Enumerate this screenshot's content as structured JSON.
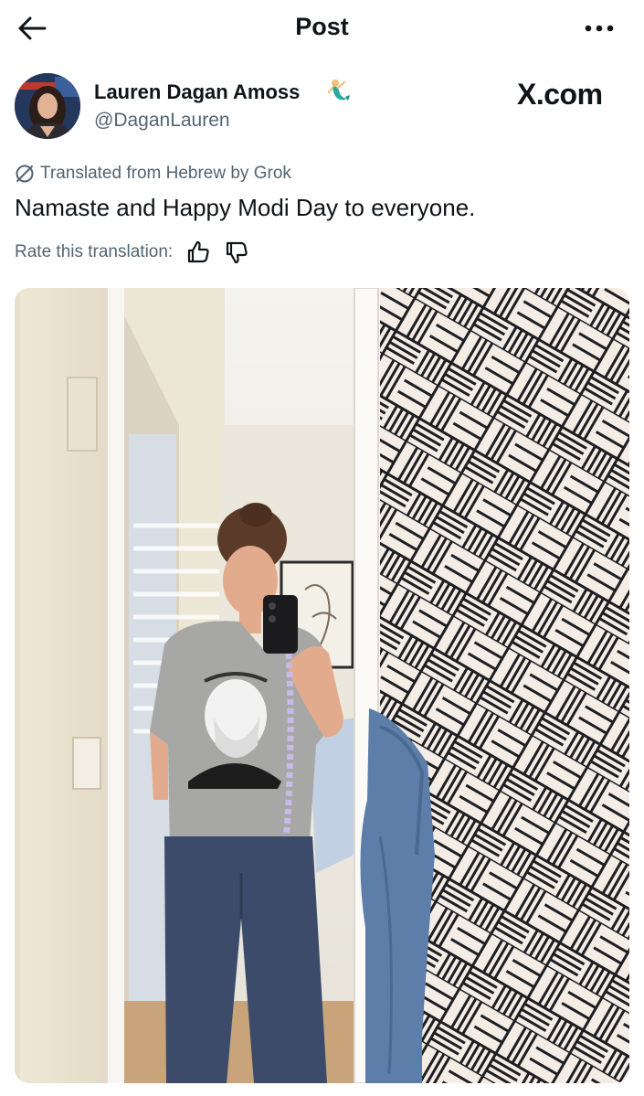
{
  "header": {
    "title": "Post"
  },
  "author": {
    "name": "Lauren Dagan Amoss",
    "handle": "@DaganLauren",
    "badge_emoji": "mermaid-emoji"
  },
  "watermark": "X.com",
  "translation": {
    "label": "Translated from Hebrew by Grok",
    "rate_label": "Rate this translation:"
  },
  "post": {
    "text": "Namaste and Happy Modi Day to everyone."
  },
  "icons": {
    "back": "arrow-left-icon",
    "more": "more-dots-icon",
    "grok": "grok-icon",
    "thumbs_up": "thumbs-up-icon",
    "thumbs_down": "thumbs-down-icon"
  },
  "colors": {
    "text": "#0f1419",
    "secondary": "#536471",
    "background": "#ffffff"
  }
}
